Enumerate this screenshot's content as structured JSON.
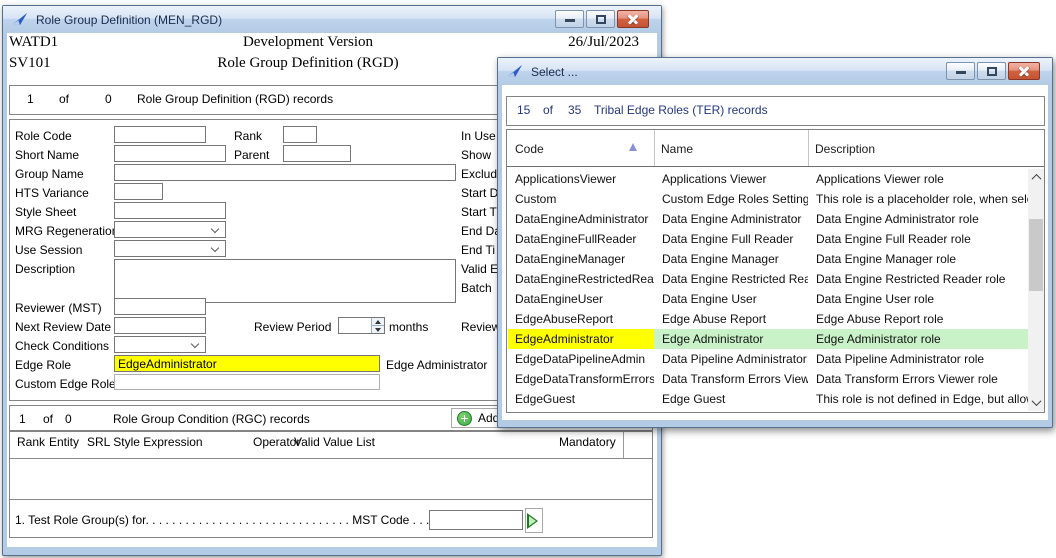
{
  "colors": {
    "highlight_yellow": "#ffff00",
    "highlight_green": "#c9f2c9",
    "accent_green": "#3fae47",
    "record_count_navy": "#25367f"
  },
  "main_window": {
    "title": "Role Group Definition (MEN_RGD)",
    "header": {
      "workstation": "WATD1",
      "version_label": "Development Version",
      "date": "26/Jul/2023",
      "screen_code": "SV101",
      "screen_title": "Role Group Definition (RGD)"
    },
    "records_bar": {
      "index": "1",
      "of_label": "of",
      "total": "0",
      "label": "Role Group Definition (RGD) records"
    },
    "form": {
      "role_code_label": "Role Code",
      "rank_label": "Rank",
      "in_use_label": "In Use",
      "short_name_label": "Short Name",
      "parent_label": "Parent",
      "show_label": "Show",
      "group_name_label": "Group Name",
      "exclude_label": "Exclud",
      "hts_variance_label": "HTS Variance",
      "start_date_label": "Start D",
      "style_sheet_label": "Style Sheet",
      "start_time_label": "Start T",
      "mrg_regeneration_label": "MRG Regeneration",
      "end_date_label": "End Da",
      "use_session_label": "Use Session",
      "end_time_label": "End Ti",
      "description_label": "Description",
      "valid_label": "Valid E",
      "batch_label": "Batch",
      "reviewer_label": "Reviewer (MST)",
      "next_review_date_label": "Next Review Date",
      "review_period_label": "Review Period",
      "months_label": "months",
      "review_label": "Review",
      "check_conditions_label": "Check Conditions",
      "edge_role_label": "Edge Role",
      "edge_role_value": "EdgeAdministrator",
      "edge_role_display": "Edge Administrator",
      "custom_edge_role_label": "Custom Edge Role"
    },
    "rgc": {
      "index": "1",
      "of_label": "of",
      "total": "0",
      "label": "Role Group Condition (RGC) records",
      "add_label": "Add",
      "columns": [
        "Rank",
        "Entity",
        "SRL Style Expression",
        "Operator",
        "Valid Value List",
        "Mandatory"
      ],
      "test_label": "1. Test Role Group(s) for. . . . . . . . . . . . . . . . . . . . . . . . . . . . . . .  MST Code . . .",
      "mst_code_value": ""
    }
  },
  "select_dialog": {
    "title": "Select ...",
    "records_bar": {
      "index": "15",
      "of_label": "of",
      "total": "35",
      "label": "Tribal Edge Roles (TER) records"
    },
    "columns": [
      "Code",
      "Name",
      "Description"
    ],
    "selected_index": 8,
    "rows": [
      {
        "code": "ApplicationsViewer",
        "name": "Applications Viewer",
        "description": "Applications Viewer role"
      },
      {
        "code": "Custom",
        "name": "Custom Edge Roles Setting",
        "description": "This role is a placeholder role, when selected"
      },
      {
        "code": "DataEngineAdministrator",
        "name": "Data Engine Administrator",
        "description": "Data Engine Administrator role"
      },
      {
        "code": "DataEngineFullReader",
        "name": "Data Engine Full Reader",
        "description": "Data Engine Full Reader role"
      },
      {
        "code": "DataEngineManager",
        "name": "Data Engine Manager",
        "description": "Data Engine Manager role"
      },
      {
        "code": "DataEngineRestrictedReader",
        "name": "Data Engine Restricted Reader",
        "description": "Data Engine Restricted Reader role"
      },
      {
        "code": "DataEngineUser",
        "name": "Data Engine User",
        "description": "Data Engine User role"
      },
      {
        "code": "EdgeAbuseReport",
        "name": "Edge Abuse Report",
        "description": "Edge Abuse Report role"
      },
      {
        "code": "EdgeAdministrator",
        "name": "Edge Administrator",
        "description": "Edge Administrator role"
      },
      {
        "code": "EdgeDataPipelineAdmin",
        "name": "Data Pipeline Administrator",
        "description": "Data Pipeline Administrator role"
      },
      {
        "code": "EdgeDataTransformErrorsViewer",
        "name": "Data Transform Errors Viewer",
        "description": "Data Transform Errors Viewer role"
      },
      {
        "code": "EdgeGuest",
        "name": "Edge Guest",
        "description": "This role is not defined in Edge, but allows a r"
      }
    ]
  }
}
